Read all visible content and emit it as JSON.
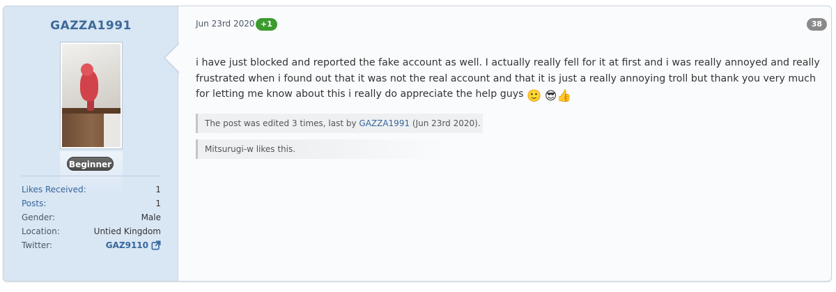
{
  "author": {
    "username": "GAZZA1991",
    "rank": "Beginner",
    "stats": [
      {
        "label": "Likes Received:",
        "value": "1",
        "is_link": true
      },
      {
        "label": "Posts:",
        "value": "1",
        "is_link": true
      },
      {
        "label": "Gender:",
        "value": "Male",
        "is_link": false
      },
      {
        "label": "Location:",
        "value": "Untied Kingdom",
        "is_link": false
      }
    ],
    "twitter": {
      "label": "Twitter:",
      "value": "GAZ9110",
      "icon": "external-link-icon"
    }
  },
  "post": {
    "date": "Jun 23rd 2020",
    "reaction_badge": "+1",
    "number": "38",
    "body": "i have just blocked and reported the fake account as well. I actually really fell for it at first and i was really annoyed and really frustrated when i found out that it was not the real account and that it is just a really annoying troll but thank you very much for letting me know about this i really do appreciate the help guys",
    "emojis": [
      "🙂",
      "😎👍"
    ],
    "edit_note": {
      "prefix": "The post was edited 3 times, last by ",
      "user": "GAZZA1991",
      "suffix": " (Jun 23rd 2020)."
    },
    "likes": "Mitsurugi-w likes this."
  },
  "colors": {
    "username": "#3e6a99",
    "sidebar_bg": "#d9e6f4",
    "plus_badge": "#3c9b2e",
    "post_number_badge": "#8a8a8a",
    "link": "#35669a"
  }
}
